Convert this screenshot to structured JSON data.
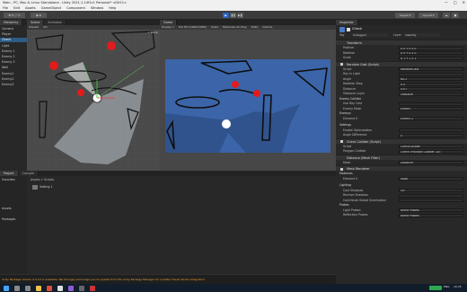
{
  "window": {
    "title": "Main - PC, Mac & Linux Standalone - Unity 2021.1.14f1c1 Personal* <DX11>",
    "controls": [
      "—",
      "□",
      "✕"
    ]
  },
  "menu": [
    "File",
    "Edit",
    "Assets",
    "GameObject",
    "Component",
    "Window",
    "Help"
  ],
  "toolbar": {
    "layers": "Layers",
    "layout": "Layout"
  },
  "hierarchy": {
    "tabs": [
      "Hierarchy"
    ],
    "items": [
      "Camera",
      "Player",
      "Check",
      "Light",
      "Enemy 1",
      "Enemy 2",
      "Enemy 3",
      "Wall",
      "Enemy1",
      "Enemy2",
      "Enemy3"
    ]
  },
  "scene": {
    "tabs": [
      "Scene",
      "Animator"
    ],
    "toolbar_label": "Shaded",
    "view2d": "2D",
    "persp": "< Persp"
  },
  "game": {
    "tabs": [
      "Game"
    ],
    "display": "Display 1",
    "resolution": "Full HD (1920x1080)",
    "scale_label": "Scale",
    "maximize": "Maximize On Play",
    "stats": "Stats",
    "gizmos": "Gizmos"
  },
  "project": {
    "tabs": [
      "Project",
      "Console"
    ],
    "breadcrumb": "Assets > Scripts",
    "items": [
      "Setting 1"
    ],
    "sidebar": [
      "Favorites",
      "Assets",
      "Packages"
    ]
  },
  "inspector": {
    "tabs": [
      "Inspector"
    ],
    "object_name": "Check",
    "tag_label": "Tag",
    "tag_value": "Untagged",
    "layer_label": "Layer",
    "layer_value": "Visibility",
    "transform_header": "Transform",
    "transform_rows": [
      {
        "label": "Position",
        "value": "X 0   Y 0   Z 0"
      },
      {
        "label": "Rotation",
        "value": "X 0   Y 0   Z 0"
      },
      {
        "label": "Scale",
        "value": "X 1   Y 1   Z 1"
      }
    ],
    "script_header": "Random Cast (Script)",
    "script_rows": [
      {
        "label": "Script",
        "value": "RandomCast"
      },
      {
        "label": "Ray In Light",
        "value": ""
      },
      {
        "label": "Angle",
        "value": "60.2"
      },
      {
        "label": "Rotation Step",
        "value": "0.5"
      },
      {
        "label": "Distance",
        "value": "4.07"
      },
      {
        "label": "Obstacle Layer",
        "value": "Obstacle"
      }
    ],
    "section2_label": "Enemy Collider",
    "section2_rows": [
      {
        "label": "Use Ray Cast",
        "value": ""
      },
      {
        "label": "Enemy Mask",
        "value": "Enemy"
      }
    ],
    "enemys_label": "Enemys",
    "enemys_rows": [
      {
        "label": "Element 0",
        "value": "Enemy 2"
      }
    ],
    "section3_label": "Settings",
    "section3_rows": [
      {
        "label": "Enable Optimization",
        "value": ""
      },
      {
        "label": "Angle Difference",
        "value": "0"
      }
    ],
    "collider_header": "Check Collider (Script)",
    "collider_rows": [
      {
        "label": "Script",
        "value": "CheckCollider"
      },
      {
        "label": "Polygon Collider",
        "value": "Check (Polygon Collider 2D)"
      }
    ],
    "mesh_filter_header": "Distance (Mesh Filter)",
    "mesh_filter_rows": [
      {
        "label": "Mesh",
        "value": "Distance"
      }
    ],
    "mesh_renderer_header": "Mesh Renderer",
    "materials_label": "Materials",
    "materials_rows": [
      {
        "label": "Element 0",
        "value": "Mask"
      }
    ],
    "lighting_label": "Lighting",
    "lighting_rows": [
      {
        "label": "Cast Shadows",
        "value": "On"
      },
      {
        "label": "Receive Shadows",
        "value": ""
      },
      {
        "label": "Contribute Global Illumination",
        "value": ""
      }
    ],
    "probes_label": "Probes",
    "probes_rows": [
      {
        "label": "Light Probes",
        "value": "Blend Probes"
      },
      {
        "label": "Reflection Probes",
        "value": "Blend Probes"
      }
    ]
  },
  "statusbar": {
    "message": "Unity Package version 2.0.12 is available. We strongly encourage you to update from the Unity Package Manager for a better Visual Studio integration"
  },
  "taskbar": {
    "icons": [
      "windows-icon",
      "search-icon",
      "taskview-icon",
      "explorer-icon",
      "chrome-icon",
      "unity-icon",
      "vs-icon",
      "terminal-icon",
      "app-icon"
    ],
    "clock": "10:25",
    "lang": "ENG"
  },
  "colors": {
    "game_bg": "#3b65a8",
    "enemy": "#e21b1b",
    "highlight": "#f2d74a",
    "accent": "#2a62c2"
  }
}
